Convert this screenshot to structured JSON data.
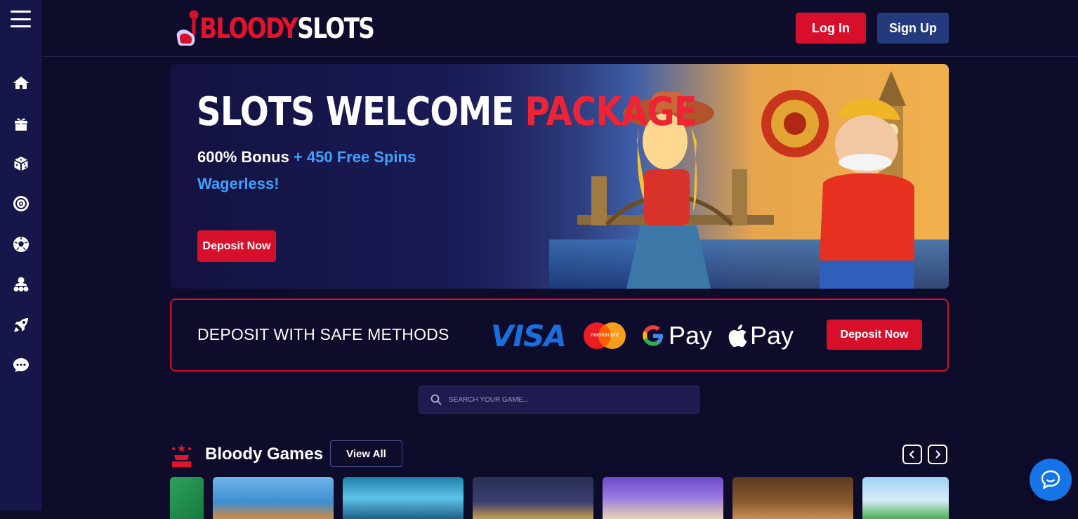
{
  "header": {
    "logo_word_red": "BLOODY",
    "logo_word_white": "SLOTS",
    "login_label": "Log In",
    "signup_label": "Sign Up"
  },
  "sidebar": {
    "items": [
      {
        "icon": "home-icon"
      },
      {
        "icon": "gift-icon"
      },
      {
        "icon": "dice-icon"
      },
      {
        "icon": "roulette-icon"
      },
      {
        "icon": "soccer-ball-icon"
      },
      {
        "icon": "live-dealer-icon"
      },
      {
        "icon": "rocket-icon"
      },
      {
        "icon": "chat-icon"
      }
    ]
  },
  "hero": {
    "title_white": "SLOTS WELCOME",
    "title_red": "PACKAGE",
    "bonus_white": "600% Bonus",
    "bonus_blue": "+ 450 Free Spins",
    "subline": "Wagerless!",
    "cta_label": "Deposit Now"
  },
  "deposit_methods": {
    "title": "DEPOSIT WITH SAFE METHODS",
    "visa": "VISA",
    "mastercard": "mastercard",
    "gpay": "Pay",
    "applepay": "Pay",
    "cta_label": "Deposit Now"
  },
  "search": {
    "placeholder": "SEARCH YOUR GAME..."
  },
  "games": {
    "title": "Bloody Games",
    "view_all_label": "View All"
  },
  "colors": {
    "accent_red": "#d6102a",
    "accent_blue": "#3ea2ff",
    "background": "#0e0c2b",
    "sidebar": "#17164a"
  }
}
